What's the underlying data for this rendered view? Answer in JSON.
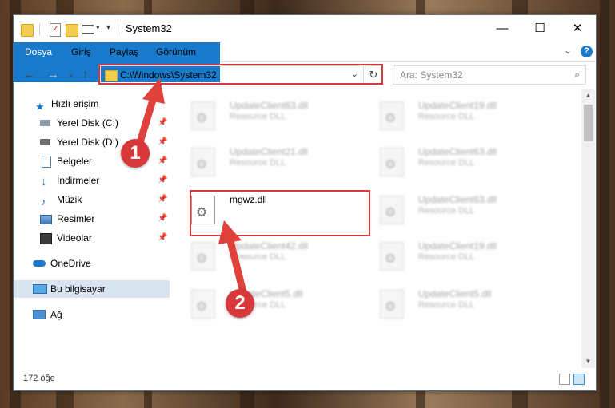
{
  "window": {
    "title": "System32",
    "minimize": "—",
    "maximize": "☐",
    "close": "✕"
  },
  "ribbon": {
    "tabs": [
      "Dosya",
      "Giriş",
      "Paylaş",
      "Görünüm"
    ],
    "expand_icon": "⌄",
    "help": "?"
  },
  "address": {
    "path": "C:\\Windows\\System32",
    "back": "←",
    "forward": "→",
    "recent": "⌄",
    "up": "↑",
    "dropdown": "⌄",
    "refresh": "↻"
  },
  "search": {
    "placeholder": "Ara: System32",
    "icon": "⌕"
  },
  "navigation": {
    "items": [
      {
        "label": "Hızlı erişim",
        "icon": "star-icon",
        "pinned": false
      },
      {
        "label": "Yerel Disk (C:)",
        "icon": "drive-icon",
        "pinned": true
      },
      {
        "label": "Yerel Disk (D:)",
        "icon": "drive-icon",
        "pinned": true
      },
      {
        "label": "Belgeler",
        "icon": "documents-icon",
        "pinned": true
      },
      {
        "label": "İndirmeler",
        "icon": "download-icon",
        "pinned": true
      },
      {
        "label": "Müzik",
        "icon": "music-icon",
        "pinned": true
      },
      {
        "label": "Resimler",
        "icon": "pictures-icon",
        "pinned": true
      },
      {
        "label": "Videolar",
        "icon": "videos-icon",
        "pinned": true
      },
      {
        "label": "OneDrive",
        "icon": "cloud-icon",
        "pinned": false
      },
      {
        "label": "Bu bilgisayar",
        "icon": "computer-icon",
        "pinned": false
      },
      {
        "label": "Ağ",
        "icon": "network-icon",
        "pinned": false
      }
    ],
    "pin_glyph": "📌"
  },
  "files": {
    "left": [
      {
        "name": "UpdateClient63.dll",
        "type": "Resource DLL"
      },
      {
        "name": "UpdateClient21.dll",
        "type": "Resource DLL"
      },
      {
        "name": "mgwz.dll",
        "type": ""
      },
      {
        "name": "UpdateClient42.dll",
        "type": "Resource DLL"
      },
      {
        "name": "UpdateClient5.dll",
        "type": "Resource DLL"
      }
    ],
    "right": [
      {
        "name": "UpdateClient19.dll",
        "type": "Resource DLL"
      },
      {
        "name": "UpdateClient63.dll",
        "type": "Resource DLL"
      },
      {
        "name": "UpdateClient63.dll",
        "type": "Resource DLL"
      },
      {
        "name": "UpdateClient19.dll",
        "type": "Resource DLL"
      },
      {
        "name": "UpdateClient5.dll",
        "type": "Resource DLL"
      }
    ]
  },
  "status": {
    "item_count": "172 öğe"
  },
  "annotations": {
    "step1": "1",
    "step2": "2",
    "color": "#d9383a"
  }
}
